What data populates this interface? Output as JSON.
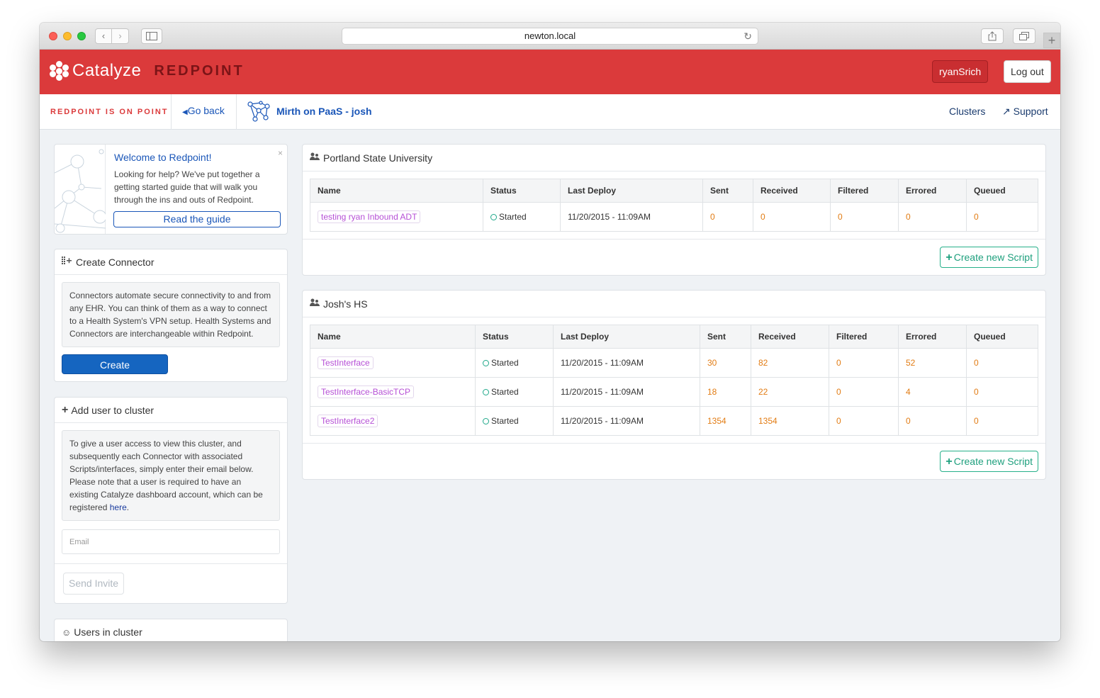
{
  "browser": {
    "url": "newton.local"
  },
  "header": {
    "brand": "Catalyze",
    "product": "REDPOINT",
    "user_button": "ryanSrich",
    "logout_button": "Log out",
    "brand_color": "#db3a3b"
  },
  "subnav": {
    "tagline": "REDPOINT IS ON POINT",
    "go_back": "Go back",
    "breadcrumb": "Mirth on PaaS - josh",
    "clusters": "Clusters",
    "support": "Support"
  },
  "welcome": {
    "title": "Welcome to Redpoint!",
    "text": "Looking for help? We've put together a getting started guide that will walk you through the ins and outs of Redpoint.",
    "button": "Read the guide",
    "close": "×"
  },
  "create_connector": {
    "title": "Create Connector",
    "text": "Connectors automate secure connectivity to and from any EHR. You can think of them as a way to connect to a Health System's VPN setup. Health Systems and Connectors are interchangeable within Redpoint.",
    "button": "Create"
  },
  "add_user": {
    "title": "Add user to cluster",
    "text": "To give a user access to view this cluster, and subsequently each Connector with associated Scripts/interfaces, simply enter their email below. Please note that a user is required to have an existing Catalyze dashboard account, which can be registered",
    "link": "here",
    "after_link": ".",
    "email_placeholder": "Email",
    "button": "Send Invite"
  },
  "users_in_cluster": {
    "title": "Users in cluster"
  },
  "columns": [
    "Name",
    "Status",
    "Last Deploy",
    "Sent",
    "Received",
    "Filtered",
    "Errored",
    "Queued"
  ],
  "organizations": [
    {
      "name": "Portland State University",
      "create_script": "Create new Script",
      "rows": [
        {
          "name": "testing ryan Inbound ADT",
          "status": "Started",
          "last_deploy": "11/20/2015 - 11:09AM",
          "sent": "0",
          "received": "0",
          "filtered": "0",
          "errored": "0",
          "queued": "0"
        }
      ]
    },
    {
      "name": "Josh's HS",
      "create_script": "Create new Script",
      "rows": [
        {
          "name": "TestInterface",
          "status": "Started",
          "last_deploy": "11/20/2015 - 11:09AM",
          "sent": "30",
          "received": "82",
          "filtered": "0",
          "errored": "52",
          "queued": "0"
        },
        {
          "name": "TestInterface-BasicTCP",
          "status": "Started",
          "last_deploy": "11/20/2015 - 11:09AM",
          "sent": "18",
          "received": "22",
          "filtered": "0",
          "errored": "4",
          "queued": "0"
        },
        {
          "name": "TestInterface2",
          "status": "Started",
          "last_deploy": "11/20/2015 - 11:09AM",
          "sent": "1354",
          "received": "1354",
          "filtered": "0",
          "errored": "0",
          "queued": "0"
        }
      ]
    }
  ]
}
